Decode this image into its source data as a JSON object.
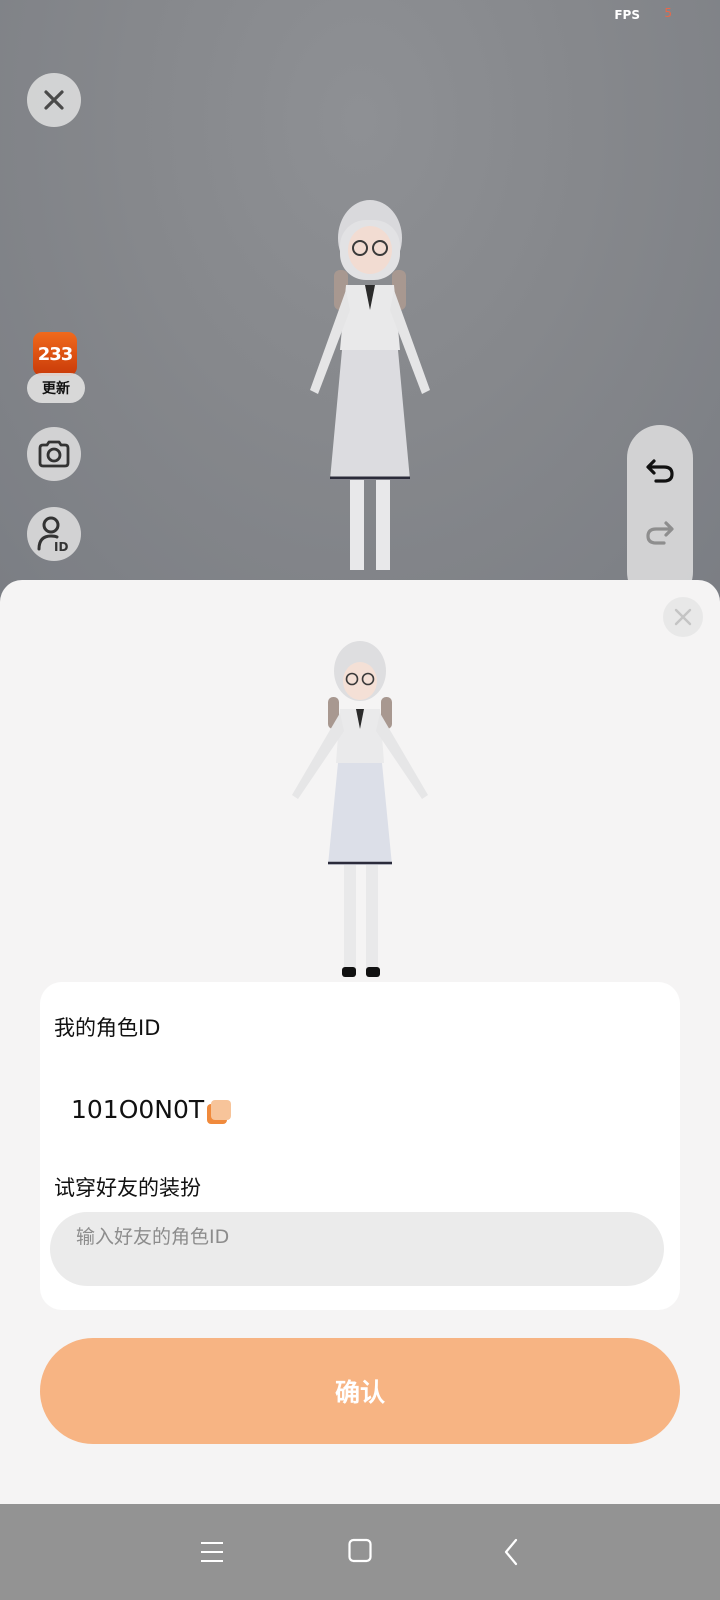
{
  "status": {
    "fps_label": "FPS",
    "fps_value": "5"
  },
  "left_tools": {
    "app_badge": "233",
    "update_label": "更新"
  },
  "card": {
    "my_id_title": "我的角色ID",
    "my_id_value": "101O0N0T",
    "try_title": "试穿好友的装扮",
    "input_placeholder": "输入好友的角色ID",
    "input_value": ""
  },
  "confirm_label": "确认",
  "colors": {
    "accent": "#f7b483",
    "badge": "#e05a14",
    "copy_icon": "#f08a3c"
  },
  "icons": {
    "close": "close-icon",
    "camera": "camera-icon",
    "id": "user-id-icon",
    "undo": "undo-icon",
    "redo": "redo-icon",
    "copy": "copy-icon",
    "nav_menu": "menu-icon",
    "nav_home": "home-icon",
    "nav_back": "back-icon"
  }
}
